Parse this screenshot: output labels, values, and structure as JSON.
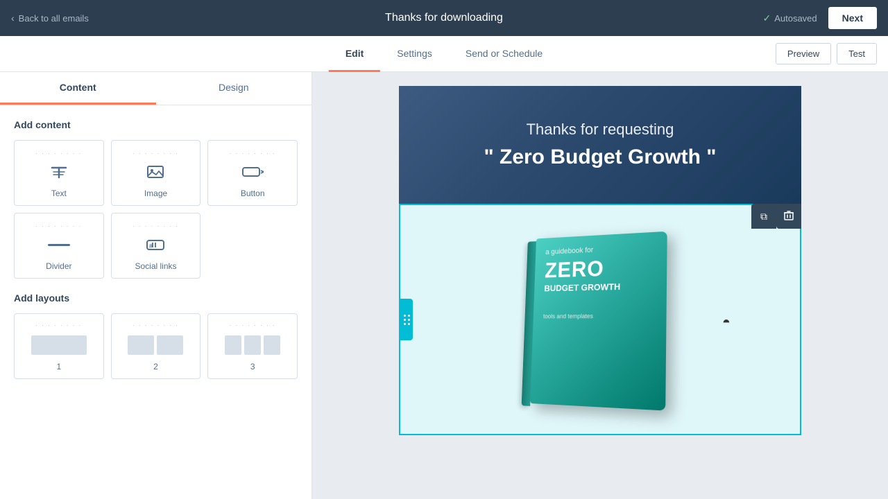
{
  "topNav": {
    "backLabel": "Back to all emails",
    "title": "Thanks for downloading",
    "autosaved": "Autosaved",
    "nextLabel": "Next"
  },
  "tabs": {
    "items": [
      {
        "id": "edit",
        "label": "Edit",
        "active": true
      },
      {
        "id": "settings",
        "label": "Settings",
        "active": false
      },
      {
        "id": "send-schedule",
        "label": "Send or Schedule",
        "active": false
      }
    ],
    "previewLabel": "Preview",
    "testLabel": "Test"
  },
  "leftPanel": {
    "tabs": [
      {
        "id": "content",
        "label": "Content",
        "active": true
      },
      {
        "id": "design",
        "label": "Design",
        "active": false
      }
    ],
    "addContentTitle": "Add content",
    "contentItems": [
      {
        "id": "text",
        "label": "Text",
        "icon": "text"
      },
      {
        "id": "image",
        "label": "Image",
        "icon": "image"
      },
      {
        "id": "button",
        "label": "Button",
        "icon": "button"
      },
      {
        "id": "divider",
        "label": "Divider",
        "icon": "divider"
      },
      {
        "id": "social-links",
        "label": "Social links",
        "icon": "social"
      }
    ],
    "addLayoutsTitle": "Add layouts",
    "layoutItems": [
      {
        "id": "1col",
        "label": "1",
        "cols": 1
      },
      {
        "id": "2col",
        "label": "2",
        "cols": 2
      },
      {
        "id": "3col",
        "label": "3",
        "cols": 3
      }
    ]
  },
  "emailPreview": {
    "heroText1": "Thanks for requesting",
    "heroText2": "\" Zero Budget Growth \"",
    "book": {
      "subtitle": "a guidebook for",
      "titleMain": "ZERO",
      "titleSub": "BUDGET GROWTH",
      "footer": "tools and templates"
    }
  },
  "sectionToolbar": {
    "copyIcon": "⧉",
    "deleteIcon": "🗑"
  }
}
